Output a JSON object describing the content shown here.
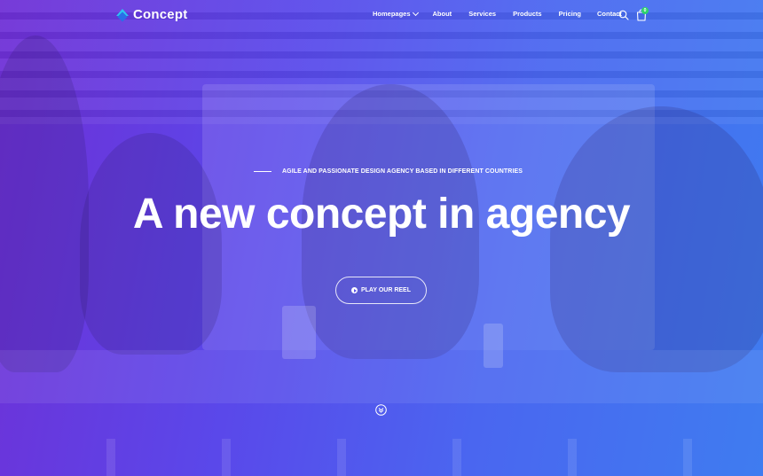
{
  "brand": {
    "name": "Concept",
    "logo_colors": [
      "#2ec7f0",
      "#2a6ee8"
    ]
  },
  "nav": {
    "items": [
      {
        "label": "Homepages",
        "has_dropdown": true
      },
      {
        "label": "About"
      },
      {
        "label": "Services"
      },
      {
        "label": "Products"
      },
      {
        "label": "Pricing"
      },
      {
        "label": "Contact"
      }
    ],
    "search_icon": "search-icon",
    "cart_icon": "shopping-bag-icon",
    "cart_count": "0"
  },
  "hero": {
    "tagline": "AGILE AND PASSIONATE DESIGN AGENCY BASED IN DIFFERENT COUNTRIES",
    "headline": "A new concept in agency",
    "play_button": "PLAY OUR REEL",
    "scroll_icon": "chevron-double-down-icon"
  },
  "colors": {
    "gradient_start": "#6f2fd6",
    "gradient_end": "#3f7cf0",
    "badge": "#2ed36a"
  }
}
